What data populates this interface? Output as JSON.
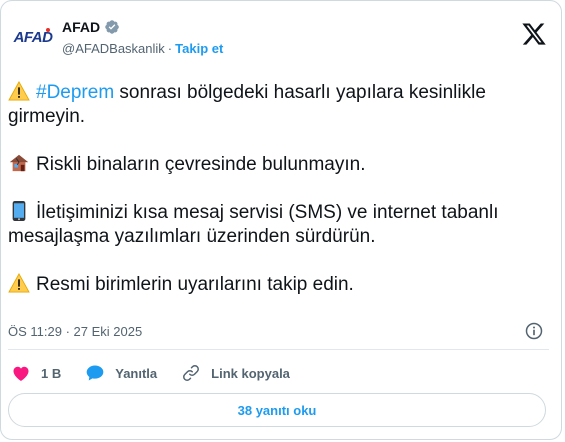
{
  "account": {
    "logo_text": "AFAD",
    "name": "AFAD",
    "handle": "@AFADBaskanlik",
    "separator": "·",
    "follow_label": "Takip et"
  },
  "tweet": {
    "p1_hashtag": "#Deprem",
    "p1_text": " sonrası bölgedeki hasarlı yapılara kesinlikle girmeyin.",
    "p2_text": "Riskli binaların çevresinde bulunmayın.",
    "p3_text": "İletişiminizi kısa mesaj servisi (SMS) ve internet tabanlı mesajlaşma yazılımları üzerinden sürdürün.",
    "p4_text": "Resmi birimlerin uyarılarını takip edin.",
    "emojis": [
      "warning-emoji",
      "house-emoji",
      "phone-emoji",
      "warning-emoji"
    ]
  },
  "meta": {
    "timestamp": "ÖS 11:29 · 27 Eki 2025"
  },
  "actions": {
    "like_count": "1 B",
    "reply_label": "Yanıtla",
    "copy_link_label": "Link kopyala"
  },
  "replies_button": "38 yanıtı oku",
  "colors": {
    "accent": "#1d9bf0",
    "like": "#f91880",
    "brand": "#1b3a8f"
  }
}
